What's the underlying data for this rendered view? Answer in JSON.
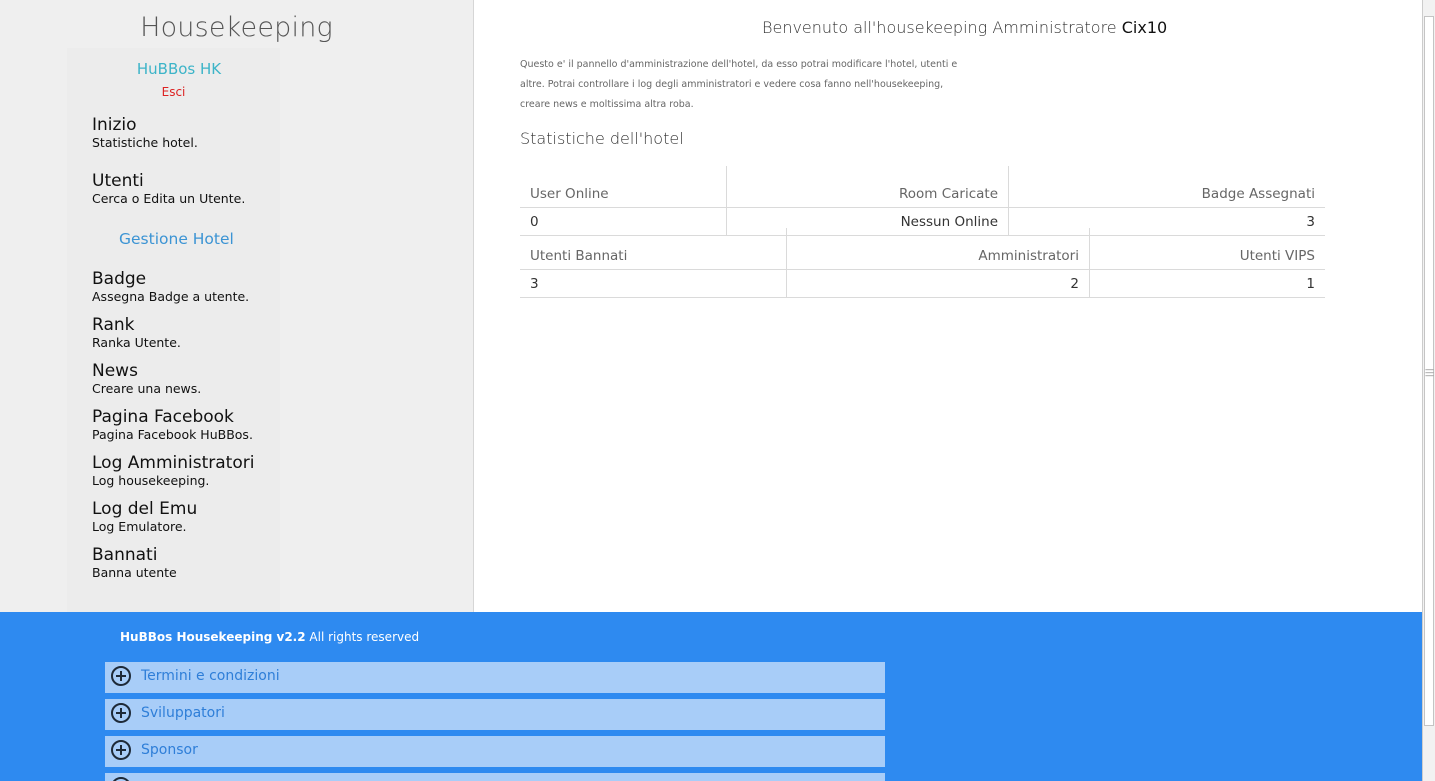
{
  "sidebar": {
    "title": "Housekeeping",
    "brand": "HuBBos HK",
    "logout": "Esci",
    "menu": [
      {
        "title": "Inizio",
        "sub": "Statistiche hotel."
      },
      {
        "title": "Utenti",
        "sub": "Cerca o Edita un Utente."
      }
    ],
    "section_label": "Gestione Hotel",
    "hotel_menu": [
      {
        "title": "Badge",
        "sub": "Assegna Badge a utente."
      },
      {
        "title": "Rank",
        "sub": "Ranka Utente."
      },
      {
        "title": "News",
        "sub": "Creare una news."
      },
      {
        "title": "Pagina Facebook",
        "sub": "Pagina Facebook HuBBos."
      },
      {
        "title": "Log Amministratori",
        "sub": "Log housekeeping."
      },
      {
        "title": "Log del Emu",
        "sub": "Log Emulatore."
      },
      {
        "title": "Bannati",
        "sub": "Banna utente"
      }
    ]
  },
  "main": {
    "welcome_text": "Benvenuto all'housekeeping Amministratore",
    "username": "Cix10",
    "intro_line1": "Questo e' il pannello d'amministrazione dell'hotel, da esso potrai modificare l'hotel, utenti e",
    "intro_line2": "altre. Potrai controllare i log degli amministratori e vedere cosa fanno nell'housekeeping,",
    "intro_line3": "creare news e moltissima altra roba.",
    "stats_title": "Statistiche dell'hotel",
    "table1": {
      "headers": [
        "User Online",
        "Room Caricate",
        "Badge Assegnati"
      ],
      "values": [
        "0",
        "Nessun Online",
        "3"
      ]
    },
    "table2": {
      "headers": [
        "Utenti Bannati",
        "Amministratori",
        "Utenti VIPS"
      ],
      "values": [
        "3",
        "2",
        "1"
      ]
    }
  },
  "footer": {
    "brand": "HuBBos Housekeeping v2.2",
    "rights": "All rights reserved",
    "accordion": [
      "Termini e condizioni",
      "Sviluppatori",
      "Sponsor"
    ]
  },
  "colors": {
    "accent_blue": "#2e8af0",
    "brand_teal": "#3cb4c8",
    "logout_red": "#dd2222",
    "accordion_bg": "#a8cdf8"
  }
}
